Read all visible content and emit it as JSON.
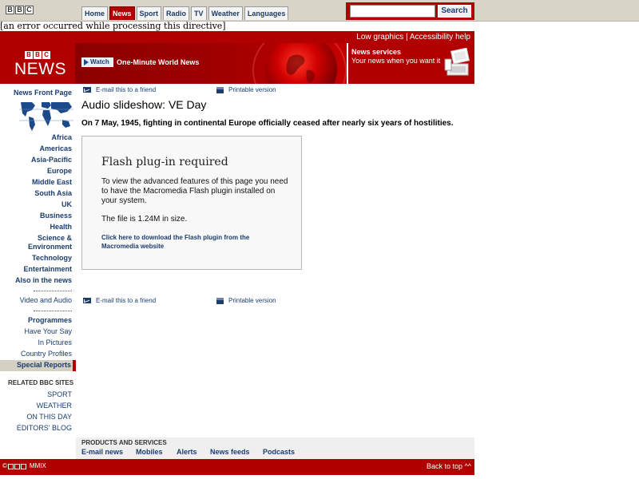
{
  "header": {
    "logo_letters": [
      "B",
      "B",
      "C"
    ],
    "tabs": [
      {
        "label": "Home",
        "active": false
      },
      {
        "label": "News",
        "active": true
      },
      {
        "label": "Sport",
        "active": false
      },
      {
        "label": "Radio",
        "active": false
      },
      {
        "label": "TV",
        "active": false
      },
      {
        "label": "Weather",
        "active": false
      },
      {
        "label": "Languages",
        "active": false
      }
    ],
    "search_value": "",
    "search_button": "Search"
  },
  "error_message": "[an error occurred while processing this directive]",
  "accessibility": {
    "low_graphics": "Low graphics",
    "separator": "|",
    "accessibility_help": "Accessibility help"
  },
  "masthead": {
    "logo_letters": [
      "B",
      "B",
      "C"
    ],
    "logo_word": "NEWS",
    "watch_label": "Watch",
    "promo_title": "One-Minute World News",
    "services_title": "News services",
    "services_sub": "Your news when you want it"
  },
  "leftnav": {
    "front_page": "News Front Page",
    "regions": [
      "Africa",
      "Americas",
      "Asia-Pacific",
      "Europe",
      "Middle East",
      "South Asia",
      "UK",
      "Business",
      "Health"
    ],
    "science_line1": "Science &",
    "science_line2": "Environment",
    "more": [
      "Technology",
      "Entertainment",
      "Also in the news"
    ],
    "video_audio": "Video and Audio",
    "programmes": "Programmes",
    "sub": [
      "Have Your Say",
      "In Pictures",
      "Country Profiles"
    ],
    "special_reports": "Special Reports",
    "related_title": "RELATED BBC SITES",
    "related": [
      "SPORT",
      "WEATHER",
      "ON THIS DAY",
      "EDITORS' BLOG"
    ]
  },
  "content": {
    "email_link": "E-mail this to a friend",
    "print_link": "Printable version",
    "title": "Audio slideshow: VE Day",
    "summary": "On 7 May, 1945, fighting in continental Europe officially ceased after nearly six years of hostilities.",
    "flash": {
      "title": "Flash plug-in required",
      "text": "To view the advanced features of this page you need to have the Macromedia Flash plugin installed on your system.",
      "size": "The file is 1.24M in size.",
      "link": "Click here to download the Flash plugin from the Macromedia website"
    }
  },
  "products": {
    "title": "PRODUCTS AND SERVICES",
    "items": [
      "E-mail news",
      "Mobiles",
      "Alerts",
      "News feeds",
      "Podcasts"
    ]
  },
  "footer": {
    "copyright_letters": [
      "B",
      "B",
      "C"
    ],
    "copyright_year": "MMIX",
    "back_to_top": "Back to top ^^"
  },
  "colors": {
    "bbc_red": "#b00000",
    "link_blue": "#1a3d6e",
    "topbar_gray": "#d8d5c8"
  }
}
